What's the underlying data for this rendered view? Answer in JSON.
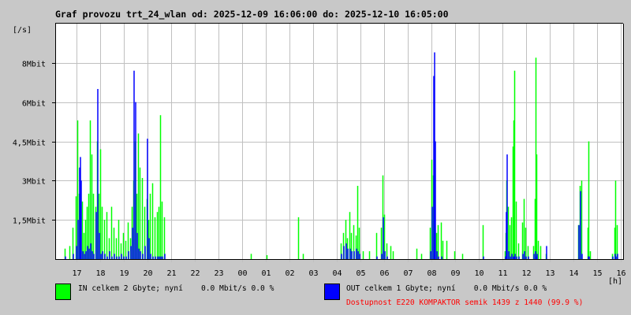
{
  "chart_data": {
    "type": "bar",
    "title": "Graf provozu trt_24_wlan od: 2025-12-09 16:06:00 do: 2025-12-10 16:05:00",
    "ylabel": "[/s]",
    "xlabel": "[h]",
    "ylim": [
      0,
      9
    ],
    "y_unit": "Mbit/s",
    "minutes_span": 1440,
    "grid": true,
    "y_ticks": [
      {
        "value": 1.5,
        "label": "1,5Mbit"
      },
      {
        "value": 3,
        "label": "3Mbit"
      },
      {
        "value": 4.5,
        "label": "4,5Mbit"
      },
      {
        "value": 6,
        "label": "6Mbit"
      },
      {
        "value": 7.5,
        "label": "8Mbit"
      }
    ],
    "x_ticks_first_minute": 54,
    "x_ticks": [
      "17",
      "18",
      "19",
      "20",
      "21",
      "22",
      "23",
      "00",
      "01",
      "02",
      "03",
      "04",
      "05",
      "06",
      "07",
      "08",
      "09",
      "10",
      "11",
      "12",
      "13",
      "14",
      "15",
      "16"
    ],
    "series_names": [
      "IN",
      "OUT"
    ],
    "colors": {
      "in": "#00ff00",
      "out": "#0000ff",
      "grid": "#c0c0c0",
      "availability": "#ff0000"
    },
    "points_minute_in_out": [
      [
        24,
        0.4,
        0.1
      ],
      [
        36,
        0.5,
        0
      ],
      [
        44,
        1.2,
        0.2
      ],
      [
        52,
        2.4,
        0.5
      ],
      [
        56,
        5.3,
        1.5
      ],
      [
        60,
        2.5,
        3.5
      ],
      [
        62,
        3.4,
        3.9
      ],
      [
        64,
        2.0,
        3.0
      ],
      [
        68,
        2.2,
        0.3
      ],
      [
        72,
        1.0,
        0.2
      ],
      [
        76,
        1.5,
        0.3
      ],
      [
        80,
        2.0,
        0.5
      ],
      [
        84,
        2.5,
        0.4
      ],
      [
        88,
        5.3,
        0.6
      ],
      [
        92,
        4.0,
        0.3
      ],
      [
        96,
        2.5,
        0.2
      ],
      [
        102,
        2.0,
        1.8
      ],
      [
        106,
        4.5,
        6.5
      ],
      [
        110,
        2.5,
        1.0
      ],
      [
        114,
        4.2,
        0.2
      ],
      [
        118,
        2.0,
        0.3
      ],
      [
        124,
        1.5,
        0.2
      ],
      [
        130,
        1.8,
        0.1
      ],
      [
        136,
        0.8,
        0.3
      ],
      [
        142,
        2.0,
        0.1
      ],
      [
        148,
        1.2,
        0.2
      ],
      [
        154,
        0.8,
        0.1
      ],
      [
        160,
        1.5,
        0.1
      ],
      [
        166,
        0.6,
        0.2
      ],
      [
        172,
        1.0,
        0.1
      ],
      [
        178,
        0.7,
        0.1
      ],
      [
        184,
        1.4,
        0.3
      ],
      [
        190,
        0.8,
        0.5
      ],
      [
        194,
        2.0,
        1.2
      ],
      [
        198,
        3.0,
        7.2
      ],
      [
        202,
        4.5,
        6.0
      ],
      [
        206,
        2.5,
        1.0
      ],
      [
        210,
        4.8,
        0.4
      ],
      [
        214,
        3.5,
        0.3
      ],
      [
        220,
        3.1,
        0.2
      ],
      [
        226,
        2.0,
        0.5
      ],
      [
        232,
        2.3,
        4.6
      ],
      [
        236,
        1.5,
        0.8
      ],
      [
        240,
        2.5,
        0.2
      ],
      [
        246,
        2.9,
        0.1
      ],
      [
        252,
        1.6,
        0.1
      ],
      [
        258,
        1.8,
        0.1
      ],
      [
        262,
        2.0,
        0.1
      ],
      [
        266,
        5.5,
        0.1
      ],
      [
        270,
        2.2,
        0.1
      ],
      [
        276,
        1.6,
        0.2
      ],
      [
        496,
        0.2,
        0
      ],
      [
        536,
        0.15,
        0
      ],
      [
        616,
        1.6,
        0
      ],
      [
        628,
        0.2,
        0
      ],
      [
        724,
        0.6,
        0.2
      ],
      [
        730,
        1.0,
        0.5
      ],
      [
        736,
        1.5,
        0.6
      ],
      [
        740,
        0.8,
        0.4
      ],
      [
        746,
        1.8,
        0.4
      ],
      [
        750,
        1.0,
        0.3
      ],
      [
        756,
        1.3,
        0.3
      ],
      [
        762,
        0.9,
        0.4
      ],
      [
        766,
        2.8,
        0.3
      ],
      [
        770,
        1.2,
        0.2
      ],
      [
        780,
        0.3,
        0
      ],
      [
        796,
        0.3,
        0
      ],
      [
        814,
        1.0,
        0.1
      ],
      [
        826,
        1.2,
        0.2
      ],
      [
        830,
        3.2,
        1.6
      ],
      [
        834,
        1.7,
        0.3
      ],
      [
        840,
        0.6,
        0.1
      ],
      [
        850,
        0.5,
        0
      ],
      [
        856,
        0.3,
        0
      ],
      [
        916,
        0.4,
        0
      ],
      [
        928,
        0.2,
        0
      ],
      [
        950,
        1.2,
        0.3
      ],
      [
        954,
        3.8,
        2.0
      ],
      [
        958,
        3.2,
        7.0
      ],
      [
        960,
        2.5,
        7.9
      ],
      [
        962,
        2.0,
        4.5
      ],
      [
        966,
        1.0,
        0.3
      ],
      [
        970,
        1.3,
        0.1
      ],
      [
        978,
        1.4,
        0.1
      ],
      [
        982,
        0.7,
        0
      ],
      [
        992,
        0.7,
        0
      ],
      [
        1012,
        0.3,
        0
      ],
      [
        1032,
        0.2,
        0
      ],
      [
        1084,
        1.3,
        0.1
      ],
      [
        1140,
        0.3,
        0.1
      ],
      [
        1142,
        1.0,
        1.8
      ],
      [
        1144,
        3.0,
        4.0
      ],
      [
        1148,
        2.0,
        0.3
      ],
      [
        1152,
        1.3,
        0.1
      ],
      [
        1156,
        1.6,
        0.2
      ],
      [
        1160,
        4.3,
        0.1
      ],
      [
        1162,
        5.3,
        0.1
      ],
      [
        1164,
        7.2,
        0.2
      ],
      [
        1168,
        2.2,
        0.1
      ],
      [
        1174,
        0.6,
        0.1
      ],
      [
        1184,
        1.4,
        0.2
      ],
      [
        1188,
        2.3,
        0.3
      ],
      [
        1192,
        1.2,
        0.1
      ],
      [
        1198,
        0.5,
        0.1
      ],
      [
        1212,
        0.5,
        0.2
      ],
      [
        1216,
        2.3,
        0.3
      ],
      [
        1218,
        7.7,
        0.1
      ],
      [
        1220,
        4.0,
        0.2
      ],
      [
        1224,
        0.7,
        0
      ],
      [
        1230,
        0.5,
        0
      ],
      [
        1244,
        0.2,
        0.5
      ],
      [
        1326,
        1.3,
        1.3
      ],
      [
        1330,
        2.8,
        2.6
      ],
      [
        1334,
        3.0,
        0.2
      ],
      [
        1350,
        1.2,
        0.1
      ],
      [
        1352,
        4.5,
        0.1
      ],
      [
        1356,
        0.3,
        0
      ],
      [
        1412,
        0.2,
        0.1
      ],
      [
        1418,
        1.2,
        0.2
      ],
      [
        1420,
        3.0,
        0.1
      ],
      [
        1424,
        1.3,
        0.2
      ]
    ]
  },
  "legend": {
    "in_text": "IN celkem 2 Gbyte; nyní    0.0 Mbit/s 0.0 %",
    "out_text": "OUT celkem 1 Gbyte; nyní    0.0 Mbit/s 0.0 %",
    "availability": "Dostupnost E220 KOMPAKTOR semik 1439 z 1440 (99.9 %)"
  }
}
